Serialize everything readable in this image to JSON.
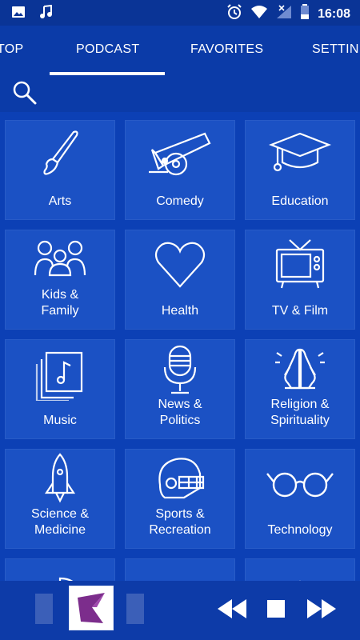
{
  "status_bar": {
    "time": "16:08",
    "icons": [
      "image-icon",
      "music-note-icon",
      "alarm-icon",
      "wifi-icon",
      "signal-icon",
      "battery-icon"
    ]
  },
  "tabs": [
    {
      "label": "TOP"
    },
    {
      "label": "PODCAST",
      "active": true
    },
    {
      "label": "FAVORITES"
    },
    {
      "label": "SETTIN"
    }
  ],
  "search": {
    "icon": "search-icon"
  },
  "categories": [
    {
      "label": "Arts",
      "icon": "paintbrush-icon"
    },
    {
      "label": "Comedy",
      "icon": "cannon-icon"
    },
    {
      "label": "Education",
      "icon": "graduation-cap-icon"
    },
    {
      "label": "Kids &\nFamily",
      "icon": "family-icon"
    },
    {
      "label": "Health",
      "icon": "heart-icon"
    },
    {
      "label": "TV & Film",
      "icon": "tv-icon"
    },
    {
      "label": "Music",
      "icon": "music-album-icon"
    },
    {
      "label": "News &\nPolitics",
      "icon": "microphone-icon"
    },
    {
      "label": "Religion &\nSpirituality",
      "icon": "praying-hands-icon"
    },
    {
      "label": "Science &\nMedicine",
      "icon": "rocket-icon"
    },
    {
      "label": "Sports &\nRecreation",
      "icon": "football-helmet-icon"
    },
    {
      "label": "Technology",
      "icon": "glasses-icon"
    }
  ],
  "player": {
    "controls": [
      "rewind-icon",
      "stop-icon",
      "fast-forward-icon"
    ]
  },
  "colors": {
    "background": "#0b3ba8",
    "tile": "#1b51c4",
    "accent": "#ffffff",
    "logo": "#7c2d8c"
  }
}
